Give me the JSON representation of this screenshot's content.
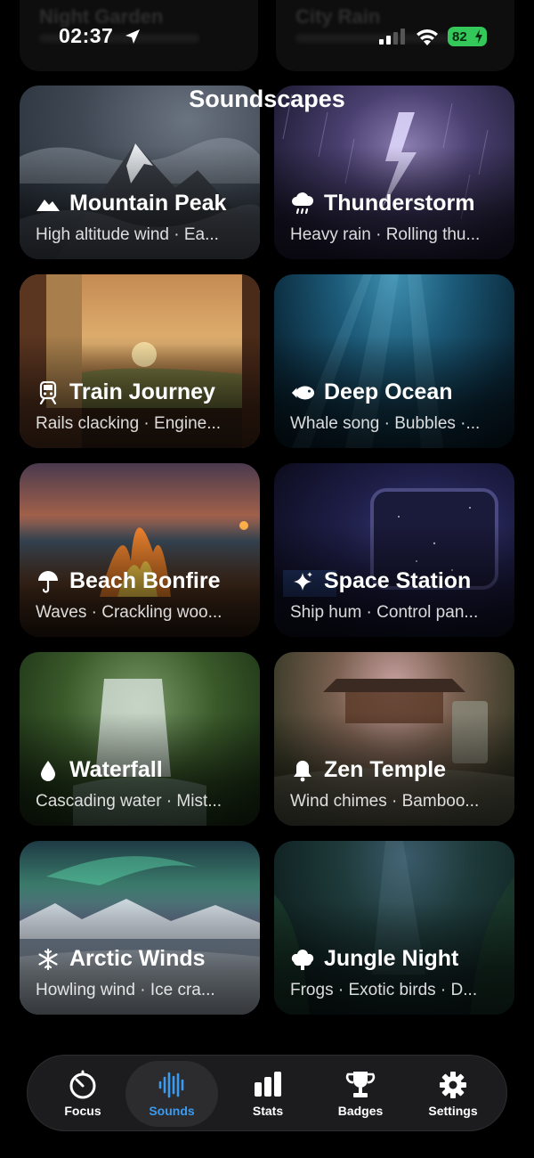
{
  "status_bar": {
    "time": "02:37",
    "battery": "82"
  },
  "page_title": "Soundscapes",
  "ghost_cards": [
    "Night Garden",
    "City Rain"
  ],
  "cards": [
    {
      "title": "Mountain Peak",
      "subtitle": "High altitude wind · Ea...",
      "icon": "mountain-icon"
    },
    {
      "title": "Thunderstorm",
      "subtitle": "Heavy rain · Rolling thu...",
      "icon": "cloud-rain-icon"
    },
    {
      "title": "Train Journey",
      "subtitle": "Rails clacking · Engine...",
      "icon": "train-icon"
    },
    {
      "title": "Deep Ocean",
      "subtitle": "Whale song · Bubbles ·...",
      "icon": "fish-icon"
    },
    {
      "title": "Beach Bonfire",
      "subtitle": "Waves · Crackling woo...",
      "icon": "umbrella-icon"
    },
    {
      "title": "Space Station",
      "subtitle": "Ship hum · Control pan...",
      "icon": "sparkles-icon"
    },
    {
      "title": "Waterfall",
      "subtitle": "Cascading water · Mist...",
      "icon": "drop-icon"
    },
    {
      "title": "Zen Temple",
      "subtitle": "Wind chimes · Bamboo...",
      "icon": "bell-icon"
    },
    {
      "title": "Arctic Winds",
      "subtitle": "Howling wind · Ice cra...",
      "icon": "snowflake-icon"
    },
    {
      "title": "Jungle Night",
      "subtitle": "Frogs · Exotic birds · D...",
      "icon": "tree-icon"
    }
  ],
  "tabs": [
    {
      "label": "Focus",
      "icon": "timer-icon",
      "active": false
    },
    {
      "label": "Sounds",
      "icon": "waveform-icon",
      "active": true
    },
    {
      "label": "Stats",
      "icon": "bar-chart-icon",
      "active": false
    },
    {
      "label": "Badges",
      "icon": "trophy-icon",
      "active": false
    },
    {
      "label": "Settings",
      "icon": "gear-icon",
      "active": false
    }
  ],
  "colors": {
    "accent": "#3a9bf0",
    "battery": "#34c759",
    "tab_bar": "#1c1c1e"
  }
}
